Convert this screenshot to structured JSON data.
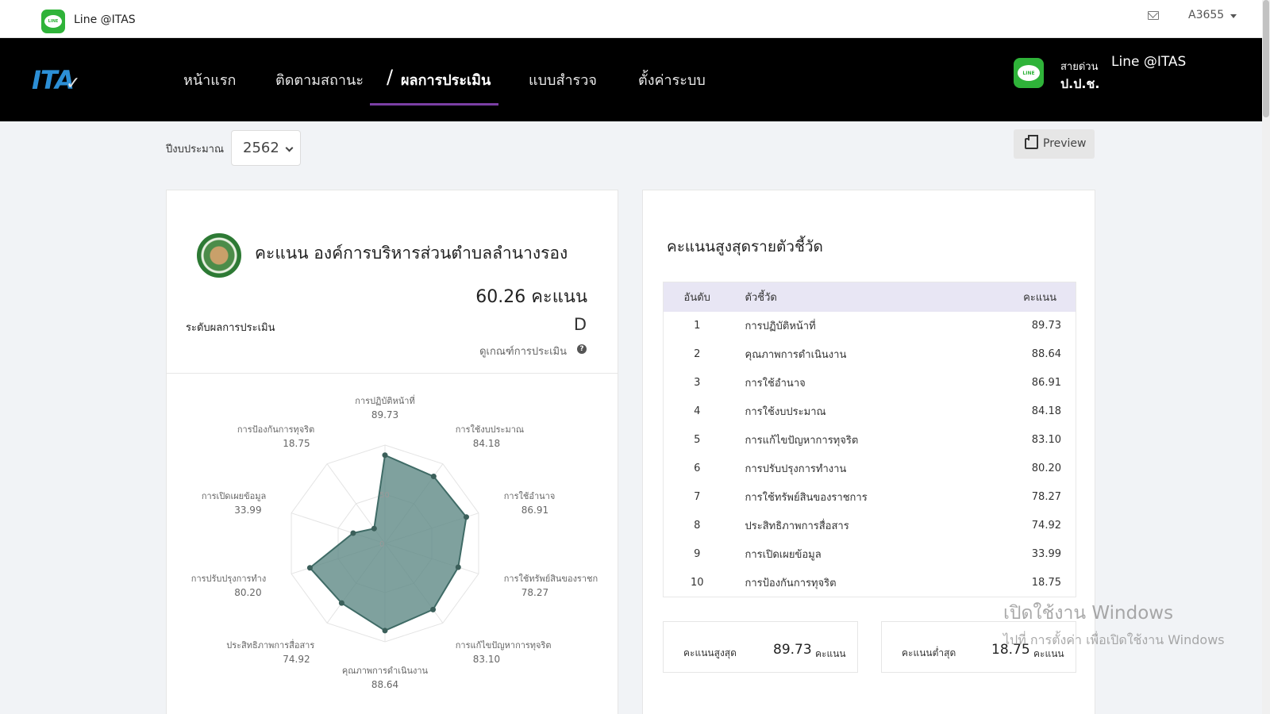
{
  "topbar": {
    "app_name": "Line @ITAS",
    "user": "A3655",
    "line_logo_text": "LINE"
  },
  "nav": {
    "brand": "ITA",
    "items": [
      "หน้าแรก",
      "ติดตามสถานะ",
      "ผลการประเมิน",
      "แบบสำรวจ",
      "ตั้งค่าระบบ"
    ],
    "active_index": 2,
    "hotline_label": "สายด่วน",
    "hotline_value": "Line @ITAS",
    "hotline_org": "ป.ป.ช."
  },
  "filter": {
    "year_label": "ปีงบประมาณ",
    "year_value": "2562",
    "preview_label": "Preview"
  },
  "summary": {
    "title": "คะแนน องค์การบริหารส่วนตำบลลำนางรอง",
    "score": "60.26 คะแนน",
    "level_label": "ระดับผลการประเมิน",
    "level": "D",
    "criteria_link": "ดูเกณฑ์การประเมิน"
  },
  "top_scores": {
    "title": "คะแนนสูงสุดรายตัวชี้วัด",
    "headers": [
      "อันดับ",
      "ตัวชี้วัด",
      "คะแนน"
    ],
    "rows": [
      [
        "1",
        "การปฏิบัติหน้าที่",
        "89.73"
      ],
      [
        "2",
        "คุณภาพการดำเนินงาน",
        "88.64"
      ],
      [
        "3",
        "การใช้อำนาจ",
        "86.91"
      ],
      [
        "4",
        "การใช้งบประมาณ",
        "84.18"
      ],
      [
        "5",
        "การแก้ไขปัญหาการทุจริต",
        "83.10"
      ],
      [
        "6",
        "การปรับปรุงการทำงาน",
        "80.20"
      ],
      [
        "7",
        "การใช้ทรัพย์สินของราชการ",
        "78.27"
      ],
      [
        "8",
        "ประสิทธิภาพการสื่อสาร",
        "74.92"
      ],
      [
        "9",
        "การเปิดเผยข้อมูล",
        "33.99"
      ],
      [
        "10",
        "การป้องกันการทุจริต",
        "18.75"
      ]
    ],
    "max_label": "คะแนนสูงสุด",
    "max_value": "89.73",
    "min_label": "คะแนนต่ำสุด",
    "min_value": "18.75",
    "unit": "คะแนน"
  },
  "chart_data": {
    "type": "radar",
    "categories": [
      "การปฏิบัติหน้าที่",
      "การใช้งบประมาณ",
      "การใช้อำนาจ",
      "การใช้ทรัพย์สินของราชการ",
      "การแก้ไขปัญหาการทุจริต",
      "คุณภาพการดำเนินงาน",
      "ประสิทธิภาพการสื่อสาร",
      "การปรับปรุงการทำงาน",
      "การเปิดเผยข้อมูล",
      "การป้องกันการทุจริต"
    ],
    "axis_labels": [
      "การปฏิบัติหน้าที่",
      "การใช้งบประมาณ",
      "การใช้อำนาจ",
      "การใช้ทรัพย์สินของราชก",
      "การแก้ไขปัญหาการทุจริต",
      "คุณภาพการดำเนินงาน",
      "ประสิทธิภาพการสื่อสาร",
      "การปรับปรุงการทำง",
      "การเปิดเผยข้อมูล",
      "การป้องกันการทุจริต"
    ],
    "values": [
      89.73,
      84.18,
      86.91,
      78.27,
      83.1,
      88.64,
      74.92,
      80.2,
      33.99,
      18.75
    ],
    "value_labels": [
      "89.73",
      "84.18",
      "86.91",
      "78.27",
      "83.10",
      "88.64",
      "74.92",
      "80.20",
      "33.99",
      "18.75"
    ],
    "scale_ticks": [
      "0",
      "50"
    ],
    "range": [
      0,
      100
    ],
    "fill_color": "#5f8a86",
    "line_color": "#3f6b66"
  },
  "watermark": {
    "line1": "เปิดใช้งาน Windows",
    "line2": "ไปที่ การตั้งค่า เพื่อเปิดใช้งาน Windows"
  }
}
